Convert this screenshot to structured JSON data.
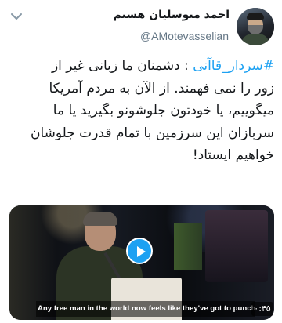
{
  "author": {
    "display_name": "احمد متوسلیان هستم",
    "handle": "@AMotevasselian"
  },
  "tweet": {
    "hashtag": "#سردار_قاآنی",
    "lines": [
      " : دشمنان ما زبانی غیر از",
      "زور را نمی فهمند.  از الآن به مردم آمریکا",
      "میگوییم، یا خودتون جلوشونو بگیرید یا ما",
      "سربازان این سرزمین با تمام قدرت جلوشان",
      "خواهیم ایستاد!"
    ]
  },
  "media": {
    "type": "video",
    "caption": "Any free man in the world now feels like they've got to punch the US",
    "duration": "۰:۴۵"
  },
  "icons": {
    "menu": "chevron-down-icon",
    "play": "play-icon"
  },
  "colors": {
    "accent": "#1da1f2",
    "text": "#14171a",
    "muted": "#657786"
  }
}
